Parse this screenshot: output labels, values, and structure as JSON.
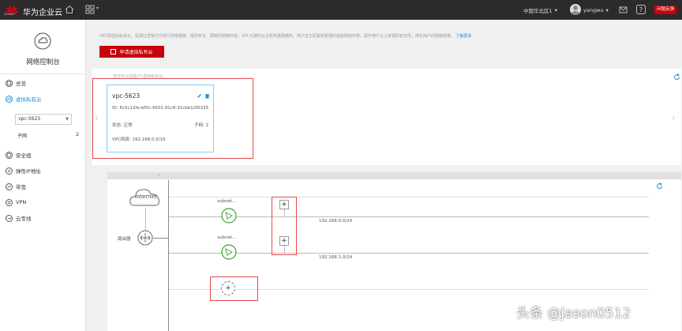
{
  "header": {
    "logo_text": "HUAWEI",
    "brand": "华为企业云",
    "region": "中国华北区1",
    "username": "yangwu",
    "ticket_label": "问题反馈"
  },
  "sidebar": {
    "title": "网络控制台",
    "items": [
      {
        "label": "总览",
        "icon": "overview-icon"
      },
      {
        "label": "虚拟私有云",
        "icon": "vpc-icon"
      },
      {
        "label": "安全组",
        "icon": "security-group-icon"
      },
      {
        "label": "弹性IP地址",
        "icon": "eip-icon"
      },
      {
        "label": "带宽",
        "icon": "bandwidth-icon"
      },
      {
        "label": "VPN",
        "icon": "vpn-icon"
      },
      {
        "label": "云专线",
        "icon": "direct-connect-icon"
      }
    ],
    "vpc_select": "vpc-5623",
    "subnet_label": "子网",
    "subnet_count": "2"
  },
  "main": {
    "info_text": "VPC即虚拟私有云，是通过逻辑方式进行网络隔离，提供安全、隔离的网络环境。VPC为弹性云主机构建隔离的、用户自主配置和管理的虚拟网络环境，提升用户云上资源的安全性，简化用户的网络部署。",
    "info_link": "了解更多",
    "apply_button": "申请虚拟私有云",
    "hint": "您还可以创建2个虚拟私有云。"
  },
  "vpc_card": {
    "name": "vpc-5623",
    "id_label": "ID:",
    "id_value": "6c5c12fe-b5fc-4501-91c8-31cbb12f0335",
    "status_label": "状态:",
    "status_value": "正常",
    "subnet_label": "子网:",
    "subnet_value": "2",
    "cidr_label": "VPC网段:",
    "cidr_value": "192.168.0.0/16"
  },
  "topology": {
    "internet": "Internet",
    "router": "路由器",
    "subnets": [
      {
        "name": "subnet...",
        "cidr": "192.168.0.0/24"
      },
      {
        "name": "subnet...",
        "cidr": "192.168.1.0/24"
      }
    ],
    "add_symbol": "+"
  },
  "watermark": "头条 @Jason0512",
  "colors": {
    "brand_red": "#c7000b",
    "link_blue": "#1890d8",
    "subnet_green": "#3aa02e"
  }
}
